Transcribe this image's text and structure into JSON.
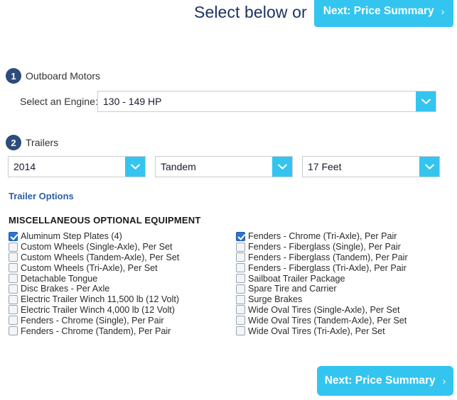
{
  "colors": {
    "accent_cyan": "#33c5ef",
    "badge_navy": "#2d4b7c",
    "heading_navy": "#1c3461",
    "link_blue": "#2c5fa8",
    "checkbox_checked": "#2c74cd"
  },
  "header": {
    "title": "Select below or",
    "next_button_label": "Next: Price Summary",
    "next_button_chevron": "›"
  },
  "sections": [
    {
      "number": "1",
      "title": "Outboard Motors",
      "field_label": "Select an Engine:",
      "engine_value": "130 - 149 HP"
    },
    {
      "number": "2",
      "title": "Trailers",
      "selects": [
        {
          "name": "trailer-year",
          "value": "2014"
        },
        {
          "name": "trailer-axle",
          "value": "Tandem"
        },
        {
          "name": "trailer-length",
          "value": "17 Feet"
        }
      ],
      "options_link": "Trailer Options"
    }
  ],
  "equipment": {
    "heading": "MISCELLANEOUS OPTIONAL EQUIPMENT",
    "left_column": [
      {
        "label": "Aluminum Step Plates (4)",
        "checked": true
      },
      {
        "label": "Custom Wheels (Single-Axle), Per Set",
        "checked": false
      },
      {
        "label": "Custom Wheels (Tandem-Axle), Per Set",
        "checked": false
      },
      {
        "label": "Custom Wheels (Tri-Axle), Per Set",
        "checked": false
      },
      {
        "label": "Detachable Tongue",
        "checked": false
      },
      {
        "label": "Disc Brakes - Per Axle",
        "checked": false
      },
      {
        "label": "Electric Trailer Winch 11,500 lb (12 Volt)",
        "checked": false
      },
      {
        "label": "Electric Trailer Winch 4,000 lb (12 Volt)",
        "checked": false
      },
      {
        "label": "Fenders - Chrome (Single), Per Pair",
        "checked": false
      },
      {
        "label": "Fenders - Chrome (Tandem), Per Pair",
        "checked": false
      }
    ],
    "right_column": [
      {
        "label": "Fenders - Chrome (Tri-Axle), Per Pair",
        "checked": true
      },
      {
        "label": "Fenders - Fiberglass (Single), Per Pair",
        "checked": false
      },
      {
        "label": "Fenders - Fiberglass (Tandem), Per Pair",
        "checked": false
      },
      {
        "label": "Fenders - Fiberglass (Tri-Axle), Per Pair",
        "checked": false
      },
      {
        "label": "Sailboat Trailer Package",
        "checked": false
      },
      {
        "label": "Spare Tire and Carrier",
        "checked": false
      },
      {
        "label": "Surge Brakes",
        "checked": false
      },
      {
        "label": "Wide Oval Tires (Single-Axle), Per Set",
        "checked": false
      },
      {
        "label": "Wide Oval Tires (Tandem-Axle), Per Set",
        "checked": false
      },
      {
        "label": "Wide Oval Tires (Tri-Axle), Per Set",
        "checked": false
      }
    ]
  },
  "footer": {
    "next_button_label": "Next: Price Summary",
    "next_button_chevron": "›"
  }
}
